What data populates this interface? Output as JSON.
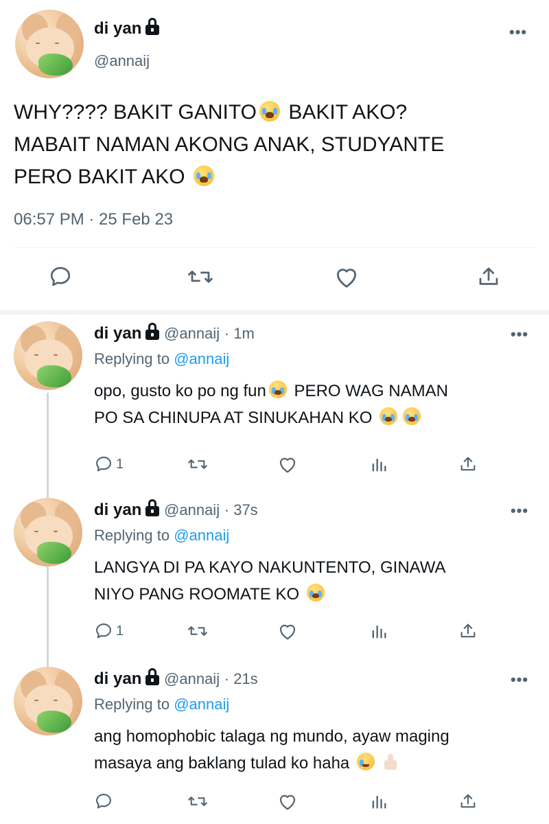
{
  "main_tweet": {
    "name": "di yan",
    "handle": "@annaij",
    "text_line1": "WHY???? BAKIT GANITO",
    "text_line1b": "BAKIT AKO?",
    "text_line2": "MABAIT NAMAN AKONG ANAK, STUDYANTE",
    "text_line3": "PERO BAKIT AKO",
    "timestamp": "06:57 PM · 25 Feb 23",
    "actions": [
      "reply-icon",
      "retweet-icon",
      "like-icon",
      "share-icon"
    ]
  },
  "replies": [
    {
      "name": "di yan",
      "handle": "@annaij",
      "time": "· 1m",
      "replying_label": "Replying to",
      "replying_to": "@annaij",
      "line1": "opo, gusto ko po ng fun",
      "line1b": "PERO WAG NAMAN",
      "line2": "PO SA CHINUPA AT SINUKAHAN KO",
      "reply_count": "1"
    },
    {
      "name": "di yan",
      "handle": "@annaij",
      "time": "· 37s",
      "replying_label": "Replying to",
      "replying_to": "@annaij",
      "line1": "LANGYA DI PA KAYO NAKUNTENTO, GINAWA",
      "line2": "NIYO PANG ROOMATE KO",
      "reply_count": "1"
    },
    {
      "name": "di yan",
      "handle": "@annaij",
      "time": "· 21s",
      "replying_label": "Replying to",
      "replying_to": "@annaij",
      "line1": "ang homophobic talaga ng mundo, ayaw maging",
      "line2": "masaya ang baklang tulad ko haha",
      "reply_count": ""
    }
  ],
  "more_label": "•••",
  "colors": {
    "text": "#0f1419",
    "secondary": "#536471",
    "link": "#1d9bf0",
    "divider": "#eff3f4"
  }
}
